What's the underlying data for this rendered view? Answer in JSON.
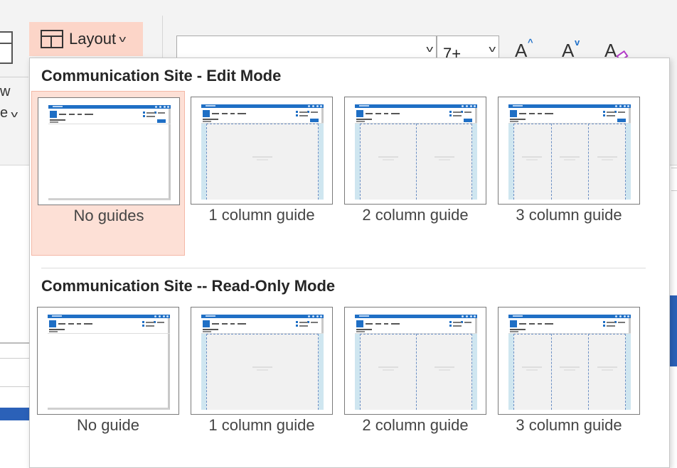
{
  "ribbon": {
    "layout_button_label": "Layout",
    "layout_icon": "layout-icon",
    "chevron_icon": "chevron-down-icon",
    "font_name_value": "",
    "font_size_value": "7+",
    "grow_font_glyph": "A",
    "shrink_font_glyph": "A",
    "clear_format_glyph": "A",
    "left_partial_word_1": "w",
    "left_partial_word_2": "e",
    "accent_color": "#fcd5c8",
    "brand_blue": "#1f6fc5"
  },
  "panel": {
    "sections": [
      {
        "title": "Communication Site - Edit Mode",
        "items": [
          {
            "label": "No guides",
            "columns": 0,
            "selected": true
          },
          {
            "label": "1 column guide",
            "columns": 1,
            "selected": false
          },
          {
            "label": "2 column guide",
            "columns": 2,
            "selected": false
          },
          {
            "label": "3 column guide",
            "columns": 3,
            "selected": false
          }
        ]
      },
      {
        "title": "Communication Site -- Read-Only Mode",
        "items": [
          {
            "label": "No guide",
            "columns": 0,
            "selected": false
          },
          {
            "label": "1 column guide",
            "columns": 1,
            "selected": false
          },
          {
            "label": "2 column guide",
            "columns": 2,
            "selected": false
          },
          {
            "label": "3 column guide",
            "columns": 3,
            "selected": false
          }
        ]
      }
    ]
  }
}
